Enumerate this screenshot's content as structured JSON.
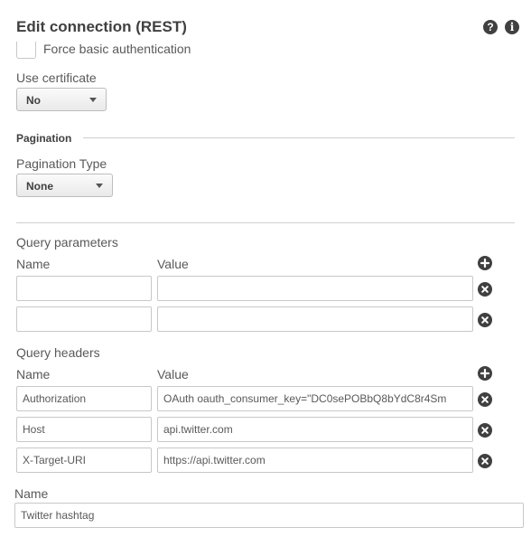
{
  "dialog": {
    "title": "Edit connection (REST)"
  },
  "auth": {
    "force_basic_label": "Force basic authentication"
  },
  "certificate": {
    "label": "Use certificate",
    "value": "No"
  },
  "pagination": {
    "section_title": "Pagination",
    "type_label": "Pagination Type",
    "type_value": "None"
  },
  "query_parameters": {
    "title": "Query parameters",
    "name_header": "Name",
    "value_header": "Value",
    "rows": [
      {
        "name": "",
        "value": ""
      },
      {
        "name": "",
        "value": ""
      }
    ]
  },
  "query_headers": {
    "title": "Query headers",
    "name_header": "Name",
    "value_header": "Value",
    "rows": [
      {
        "name": "Authorization",
        "value": "OAuth oauth_consumer_key=\"DC0sePOBbQ8bYdC8r4Sm"
      },
      {
        "name": "Host",
        "value": "api.twitter.com"
      },
      {
        "name": "X-Target-URI",
        "value": "https://api.twitter.com"
      }
    ]
  },
  "connection_name": {
    "label": "Name",
    "value": "Twitter hashtag"
  },
  "icons": {
    "help": "help-icon",
    "info": "info-icon",
    "add": "add-icon",
    "remove": "remove-icon"
  }
}
